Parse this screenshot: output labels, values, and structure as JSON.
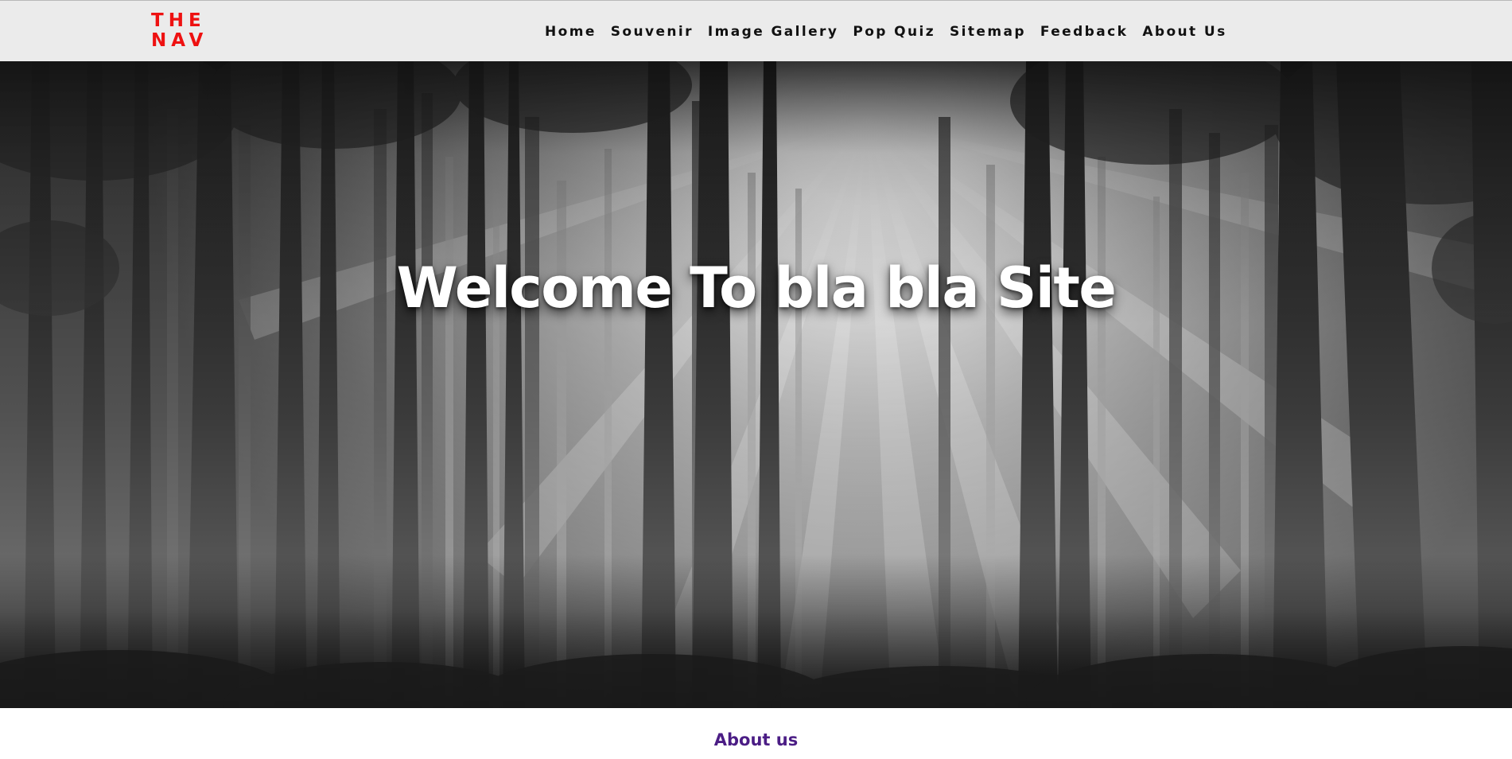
{
  "brand": {
    "line1": "THE",
    "line2": "NAV",
    "color": "#ee1111"
  },
  "nav": {
    "items": [
      {
        "label": "Home"
      },
      {
        "label": "Souvenir"
      },
      {
        "label": "Image Gallery"
      },
      {
        "label": "Pop Quiz"
      },
      {
        "label": "Sitemap"
      },
      {
        "label": "Feedback"
      },
      {
        "label": "About Us"
      }
    ]
  },
  "hero": {
    "title": "Welcome To bla bla Site",
    "image": "forest-sunbeams-photo-grayscale"
  },
  "about": {
    "heading": "About us",
    "color": "#4b1d85"
  }
}
